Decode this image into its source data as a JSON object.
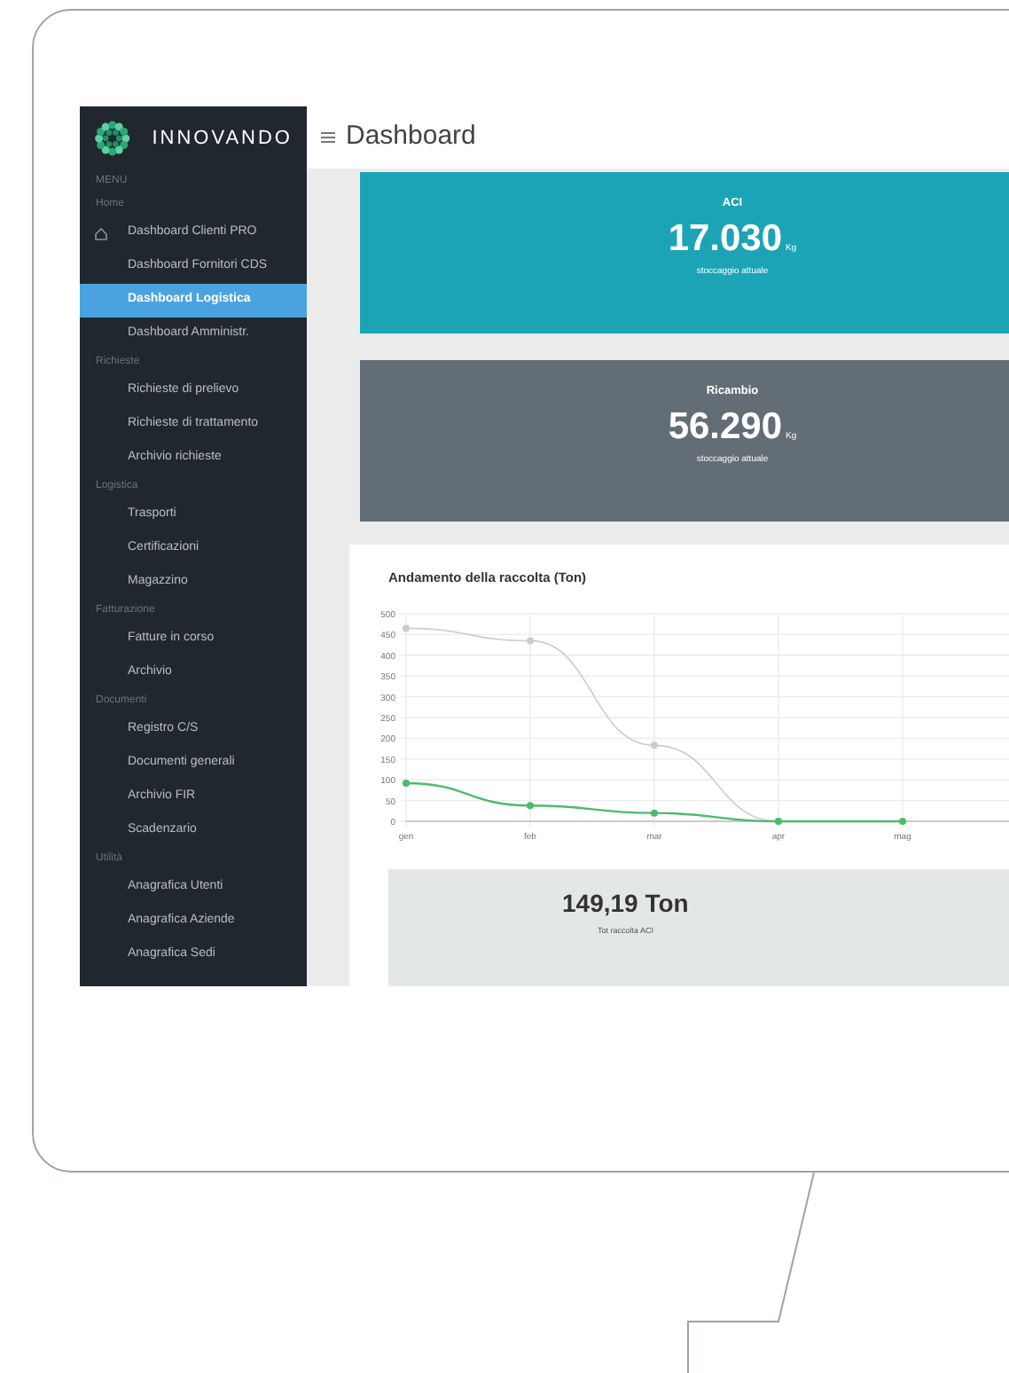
{
  "brand": "INNOVANDO",
  "menu_label": "MENU",
  "sidebar": [
    {
      "heading": "Home",
      "items": [
        {
          "label": "Dashboard Clienti PRO",
          "selected": false,
          "icon": true
        },
        {
          "label": "Dashboard Fornitori CDS",
          "selected": false,
          "icon": false
        },
        {
          "label": "Dashboard Logistica",
          "selected": true,
          "icon": false
        },
        {
          "label": "Dashboard Amministr.",
          "selected": false,
          "icon": false
        }
      ]
    },
    {
      "heading": "Richieste",
      "items": [
        {
          "label": "Richieste di prelievo",
          "selected": false,
          "icon": false
        },
        {
          "label": "Richieste di trattamento",
          "selected": false,
          "icon": false
        },
        {
          "label": "Archivio richieste",
          "selected": false,
          "icon": false
        }
      ]
    },
    {
      "heading": "Logistica",
      "items": [
        {
          "label": "Trasporti",
          "selected": false,
          "icon": false
        },
        {
          "label": "Certificazioni",
          "selected": false,
          "icon": false
        },
        {
          "label": "Magazzino",
          "selected": false,
          "icon": false
        }
      ]
    },
    {
      "heading": "Fatturazione",
      "items": [
        {
          "label": "Fatture in corso",
          "selected": false,
          "icon": false
        },
        {
          "label": "Archivio",
          "selected": false,
          "icon": false
        }
      ]
    },
    {
      "heading": "Documenti",
      "items": [
        {
          "label": "Registro C/S",
          "selected": false,
          "icon": false
        },
        {
          "label": "Documenti generali",
          "selected": false,
          "icon": false
        },
        {
          "label": "Archivio FIR",
          "selected": false,
          "icon": false
        },
        {
          "label": "Scadenzario",
          "selected": false,
          "icon": false
        }
      ]
    },
    {
      "heading": "Utilità",
      "items": [
        {
          "label": "Anagrafica Utenti",
          "selected": false,
          "icon": false
        },
        {
          "label": "Anagrafica Aziende",
          "selected": false,
          "icon": false
        },
        {
          "label": "Anagrafica Sedi",
          "selected": false,
          "icon": false
        }
      ]
    }
  ],
  "page_title": "Dashboard",
  "stock_cards": [
    {
      "title": "ACI",
      "value": "17.030",
      "unit": "Kg",
      "caption": "stoccaggio attuale",
      "color": "#1ca4b6"
    },
    {
      "title": "Ricambio",
      "value": "56.290",
      "unit": "Kg",
      "caption": "stoccaggio attuale",
      "color": "#636d76"
    }
  ],
  "chart_panel": {
    "title": "Andamento della raccolta (Ton)",
    "chart_data": {
      "type": "line",
      "grid": true,
      "categories": [
        "gen",
        "feb",
        "mar",
        "apr",
        "mag"
      ],
      "ylim": [
        0,
        500
      ],
      "yticks": [
        0,
        50,
        100,
        150,
        200,
        250,
        300,
        350,
        400,
        450,
        500
      ],
      "series": [
        {
          "color": "#cccccc",
          "marker": true,
          "values": [
            465,
            435,
            183,
            0,
            null
          ]
        },
        {
          "color": "#4cbb6c",
          "marker": true,
          "values": [
            92,
            38,
            20,
            0,
            0
          ]
        }
      ]
    }
  },
  "total": {
    "value": "149,19 Ton",
    "caption": "Tot raccolta ACI"
  }
}
